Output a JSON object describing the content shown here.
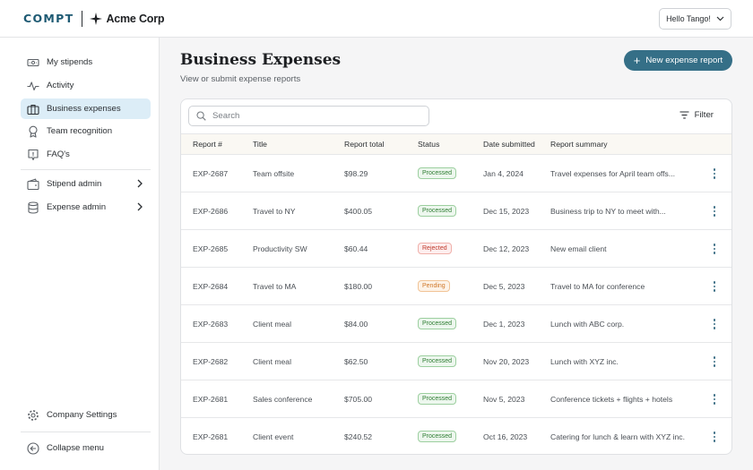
{
  "header": {
    "logo_left": "COMPT",
    "logo_right": "Acme Corp",
    "user_menu_label": "Hello Tango!"
  },
  "sidebar": {
    "items": [
      {
        "label": "My stipends",
        "icon": "money-icon"
      },
      {
        "label": "Activity",
        "icon": "activity-icon"
      },
      {
        "label": "Business expenses",
        "icon": "briefcase-icon",
        "active": true
      },
      {
        "label": "Team recognition",
        "icon": "award-icon"
      },
      {
        "label": "FAQ's",
        "icon": "help-icon"
      }
    ],
    "admin_items": [
      {
        "label": "Stipend admin",
        "icon": "wallet-icon"
      },
      {
        "label": "Expense admin",
        "icon": "database-icon"
      }
    ],
    "settings_label": "Company Settings",
    "collapse_label": "Collapse menu"
  },
  "main": {
    "title": "Business Expenses",
    "subtitle": "View or submit expense reports",
    "new_button_label": "New expense report",
    "search_placeholder": "Search",
    "filter_label": "Filter"
  },
  "table": {
    "columns": [
      "Report #",
      "Title",
      "Report total",
      "Status",
      "Date submitted",
      "Report summary"
    ],
    "rows": [
      {
        "id": "EXP-2687",
        "title": "Team offsite",
        "total": "$98.29",
        "status": "Processed",
        "date": "Jan 4, 2024",
        "summary": "Travel expenses for April team offs..."
      },
      {
        "id": "EXP-2686",
        "title": "Travel to NY",
        "total": "$400.05",
        "status": "Processed",
        "date": "Dec 15, 2023",
        "summary": "Business trip to NY to meet with..."
      },
      {
        "id": "EXP-2685",
        "title": "Productivity SW",
        "total": "$60.44",
        "status": "Rejected",
        "date": "Dec 12, 2023",
        "summary": "New email client"
      },
      {
        "id": "EXP-2684",
        "title": "Travel to MA",
        "total": "$180.00",
        "status": "Pending",
        "date": "Dec 5, 2023",
        "summary": "Travel to MA for conference"
      },
      {
        "id": "EXP-2683",
        "title": "Client meal",
        "total": "$84.00",
        "status": "Processed",
        "date": "Dec 1, 2023",
        "summary": "Lunch with ABC corp."
      },
      {
        "id": "EXP-2682",
        "title": "Client meal",
        "total": "$62.50",
        "status": "Processed",
        "date": "Nov 20, 2023",
        "summary": "Lunch with XYZ inc."
      },
      {
        "id": "EXP-2681",
        "title": "Sales conference",
        "total": "$705.00",
        "status": "Processed",
        "date": "Nov 5, 2023",
        "summary": "Conference tickets + flights + hotels"
      },
      {
        "id": "EXP-2681",
        "title": "Client event",
        "total": "$240.52",
        "status": "Processed",
        "date": "Oct 16, 2023",
        "summary": "Catering for lunch & learn with XYZ inc."
      }
    ]
  },
  "colors": {
    "accent": "#356f87",
    "active_nav": "#dcedf7",
    "processed": "#2e7d32",
    "rejected": "#c0392b",
    "pending": "#d0782a"
  }
}
